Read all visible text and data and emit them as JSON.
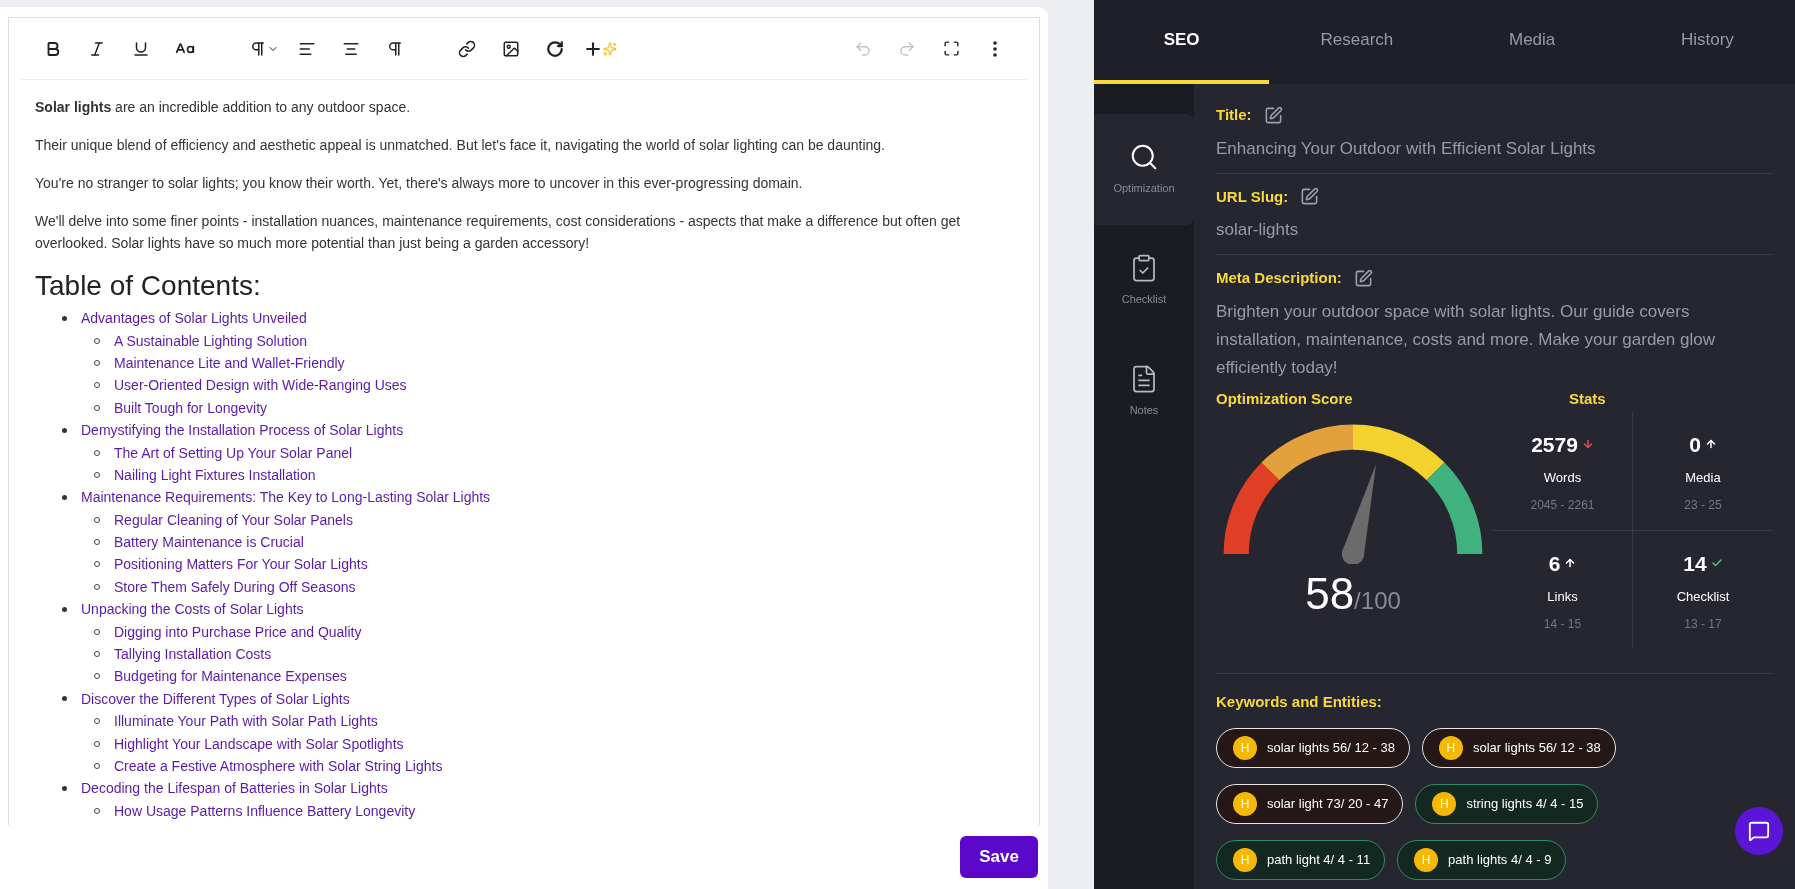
{
  "toolbar": {
    "history_buttons": [
      {
        "disabled": true
      },
      {
        "disabled": true
      }
    ]
  },
  "editor": {
    "paragraphs": [
      "**Solar lights** are an incredible addition to any outdoor space.",
      "Their unique blend of efficiency and aesthetic appeal is unmatched. But let's face it, navigating the world of solar lighting can be daunting.",
      "You're no stranger to solar lights; you know their worth. Yet, there's always more to uncover in this ever-progressing domain.",
      "We'll delve into some finer points - installation nuances, maintenance requirements, cost considerations - aspects that make a difference but often get overlooked. Solar lights have so much more potential than just being a garden accessory!"
    ],
    "heading": "Table of Contents:",
    "toc": [
      {
        "label": "Advantages of Solar Lights Unveiled",
        "children": [
          {
            "label": "A Sustainable Lighting Solution"
          },
          {
            "label": "Maintenance Lite and Wallet-Friendly"
          },
          {
            "label": "User-Oriented Design with Wide-Ranging Uses"
          },
          {
            "label": "Built Tough for Longevity"
          }
        ]
      },
      {
        "label": "Demystifying the Installation Process of Solar Lights",
        "children": [
          {
            "label": "The Art of Setting Up Your Solar Panel"
          },
          {
            "label": "Nailing Light Fixtures Installation"
          }
        ]
      },
      {
        "label": "Maintenance Requirements: The Key to Long-Lasting Solar Lights",
        "children": [
          {
            "label": "Regular Cleaning of Your Solar Panels"
          },
          {
            "label": "Battery Maintenance is Crucial"
          },
          {
            "label": "Positioning Matters For Your Solar Lights"
          },
          {
            "label": "Store Them Safely During Off Seasons"
          }
        ]
      },
      {
        "label": "Unpacking the Costs of Solar Lights",
        "children": [
          {
            "label": "Digging into Purchase Price and Quality"
          },
          {
            "label": "Tallying Installation Costs"
          },
          {
            "label": "Budgeting for Maintenance Expenses"
          }
        ]
      },
      {
        "label": "Discover the Different Types of Solar Lights",
        "children": [
          {
            "label": "Illuminate Your Path with Solar Path Lights"
          },
          {
            "label": "Highlight Your Landscape with Solar Spotlights"
          },
          {
            "label": "Create a Festive Atmosphere with Solar String Lights"
          }
        ]
      },
      {
        "label": "Decoding the Lifespan of Batteries in Solar Lights",
        "children": [
          {
            "label": "How Usage Patterns Influence Battery Longevity"
          }
        ]
      }
    ]
  },
  "save_button": "Save",
  "tabs": [
    {
      "label": "SEO",
      "selected": true
    },
    {
      "label": "Research",
      "selected": false
    },
    {
      "label": "Media",
      "selected": false
    },
    {
      "label": "History",
      "selected": false
    }
  ],
  "sidebar": {
    "items": [
      {
        "kind": "optimization",
        "label": "Optimization",
        "selected": true
      },
      {
        "kind": "checklist",
        "label": "Checklist",
        "selected": false
      },
      {
        "kind": "notes",
        "label": "Notes",
        "selected": false
      }
    ]
  },
  "fields": [
    {
      "label": "Title:",
      "value": "Enhancing Your Outdoor with Efficient Solar Lights"
    },
    {
      "label": "URL Slug:",
      "value": "solar-lights"
    },
    {
      "label": "Meta Description:",
      "value": "Brighten your outdoor space with solar lights. Our guide covers installation, maintenance, costs and more. Make your garden glow efficiently today!"
    }
  ],
  "score": {
    "heading": "Optimization Score",
    "value": "58",
    "max": "/100",
    "level": 0.58
  },
  "stats": {
    "heading": "Stats",
    "items": [
      {
        "value": "2579",
        "kind": "down",
        "label": "Words",
        "range": "2045 - 2261"
      },
      {
        "value": "0",
        "kind": "up",
        "label": "Media",
        "range": "23 - 25"
      },
      {
        "value": "6",
        "kind": "up",
        "label": "Links",
        "range": "14 - 15"
      },
      {
        "value": "14",
        "kind": "check",
        "label": "Checklist",
        "range": "13 - 17"
      }
    ]
  },
  "keywords": {
    "heading": "Keywords and Entities:",
    "items": [
      {
        "badge": "H",
        "label": "solar lights 56/ 12 - 38",
        "color": "#e5e5e5"
      },
      {
        "badge": "H",
        "label": "solar lights 56/ 12 - 38",
        "color": "#e5e5e5"
      },
      {
        "badge": "H",
        "label": "solar light 73/ 20 - 47",
        "color": "#e5e5e5"
      },
      {
        "badge": "H",
        "label": "string lights 4/ 4 - 15",
        "color": "#2e8b62"
      },
      {
        "badge": "H",
        "label": "path light 4/ 4 - 11",
        "color": "#2e8b62"
      },
      {
        "badge": "H",
        "label": "path lights 4/ 4 - 9",
        "color": "#2e8b62"
      }
    ]
  }
}
